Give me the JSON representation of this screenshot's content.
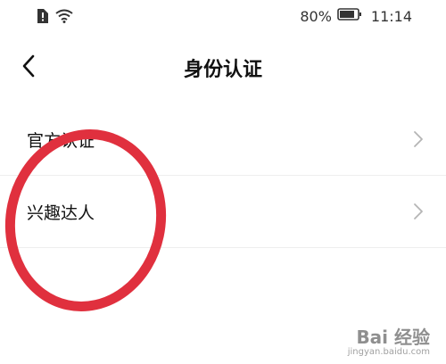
{
  "status_bar": {
    "battery_percent": "80%",
    "time": "11:14",
    "icons": [
      "sim-alert-icon",
      "wifi-icon",
      "battery-icon"
    ]
  },
  "header": {
    "back_icon": "chevron-left-icon",
    "title": "身份认证"
  },
  "list": {
    "items": [
      {
        "label": "官方认证",
        "icon": "chevron-right-icon"
      },
      {
        "label": "兴趣达人",
        "icon": "chevron-right-icon"
      }
    ]
  },
  "annotation": {
    "shape": "ellipse",
    "color": "#e0303e",
    "target": "兴趣达人"
  },
  "watermark": {
    "brand": "Bai 经验",
    "url": "jingyan.baidu.com"
  },
  "colors": {
    "background": "#ffffff",
    "text": "#111111",
    "divider": "#eeeeee",
    "chevron": "#b5b5b5",
    "annotation": "#e0303e"
  }
}
